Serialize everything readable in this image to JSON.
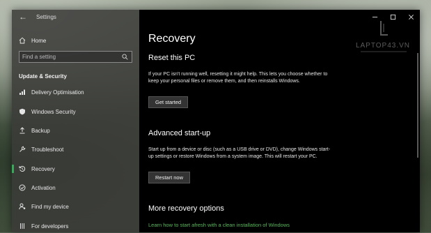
{
  "window": {
    "title": "Settings",
    "back_glyph": "←"
  },
  "sidebar": {
    "home_label": "Home",
    "search_placeholder": "Find a setting",
    "section_title": "Update & Security",
    "items": [
      {
        "label": "Delivery Optimisation",
        "icon": "delivery-optimisation-icon",
        "selected": false
      },
      {
        "label": "Windows Security",
        "icon": "shield-icon",
        "selected": false
      },
      {
        "label": "Backup",
        "icon": "backup-icon",
        "selected": false
      },
      {
        "label": "Troubleshoot",
        "icon": "wrench-icon",
        "selected": false
      },
      {
        "label": "Recovery",
        "icon": "recovery-icon",
        "selected": true
      },
      {
        "label": "Activation",
        "icon": "activation-icon",
        "selected": false
      },
      {
        "label": "Find my device",
        "icon": "person-location-icon",
        "selected": false
      },
      {
        "label": "For developers",
        "icon": "developer-icon",
        "selected": false
      }
    ]
  },
  "content": {
    "page_title": "Recovery",
    "reset": {
      "heading": "Reset this PC",
      "description": "If your PC isn't running well, resetting it might help. This lets you choose whether to keep your personal files or remove them, and then reinstalls Windows.",
      "button": "Get started"
    },
    "advanced": {
      "heading": "Advanced start-up",
      "description": "Start up from a device or disc (such as a USB drive or DVD), change Windows start-up settings or restore Windows from a system image. This will restart your PC.",
      "button": "Restart now"
    },
    "more": {
      "heading": "More recovery options",
      "link": "Learn how to start afresh with a clean installation of Windows"
    }
  },
  "watermark": {
    "text": "LAPTOP43.VN"
  },
  "colors": {
    "accent": "#3aa85a",
    "link": "#58b85a",
    "content_bg": "#000000",
    "sidebar_bg": "#3a3a38"
  }
}
